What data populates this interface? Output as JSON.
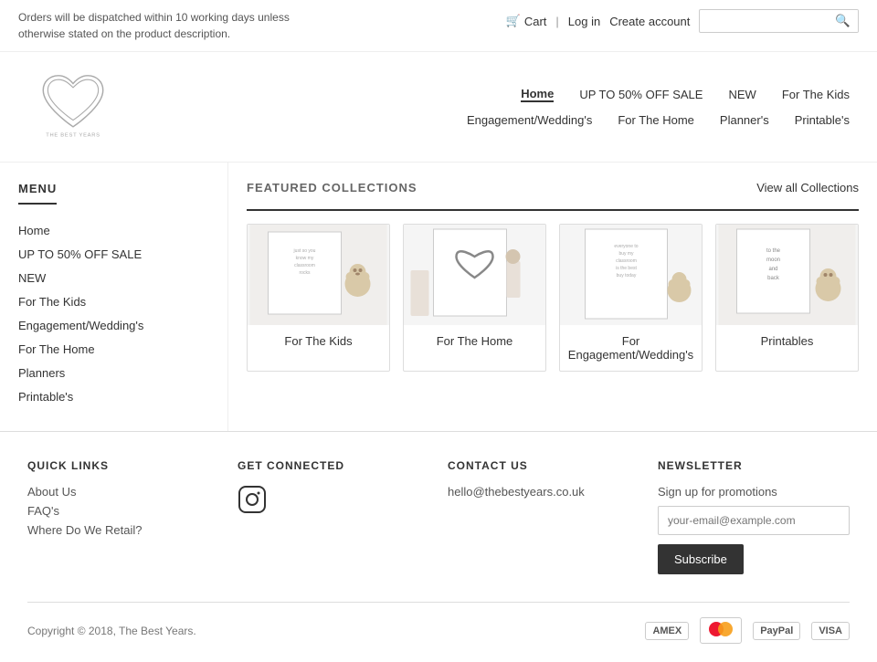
{
  "topbar": {
    "notice": "Orders will be dispatched within 10 working days unless otherwise stated on the product description.",
    "cart_label": "Cart",
    "login_label": "Log in",
    "create_account_label": "Create account",
    "search_placeholder": ""
  },
  "header": {
    "logo_alt": "The Best Years",
    "logo_text_line1": "THE BEST YEARS",
    "nav": {
      "items": [
        {
          "label": "Home",
          "active": true
        },
        {
          "label": "UP TO 50% OFF SALE",
          "active": false
        },
        {
          "label": "NEW",
          "active": false
        },
        {
          "label": "For The Kids",
          "active": false
        },
        {
          "label": "Engagement/Wedding's",
          "active": false
        },
        {
          "label": "For The Home",
          "active": false
        },
        {
          "label": "Planner's",
          "active": false
        },
        {
          "label": "Printable's",
          "active": false
        }
      ]
    }
  },
  "sidebar": {
    "menu_label": "MENU",
    "items": [
      {
        "label": "Home"
      },
      {
        "label": "UP TO 50% OFF SALE"
      },
      {
        "label": "NEW"
      },
      {
        "label": "For The Kids"
      },
      {
        "label": "Engagement/Wedding's"
      },
      {
        "label": "For The Home"
      },
      {
        "label": "Planners"
      },
      {
        "label": "Printable's"
      }
    ]
  },
  "collections": {
    "section_title": "FEATURED COLLECTIONS",
    "view_all_label": "View all Collections",
    "items": [
      {
        "label": "For The Kids"
      },
      {
        "label": "For The Home"
      },
      {
        "label": "For Engagement/Wedding's"
      },
      {
        "label": "Printables"
      }
    ]
  },
  "footer": {
    "quick_links_title": "QUICK LINKS",
    "quick_links": [
      {
        "label": "About Us"
      },
      {
        "label": "FAQ's"
      },
      {
        "label": "Where Do We Retail?"
      }
    ],
    "get_connected_title": "GET CONNECTED",
    "contact_title": "CONTACT US",
    "contact_email": "hello@thebestyears.co.uk",
    "newsletter_title": "NEWSLETTER",
    "newsletter_note": "Sign up for promotions",
    "newsletter_placeholder": "your-email@example.com",
    "subscribe_label": "Subscribe",
    "copyright": "Copyright © 2018, The Best Years.",
    "payment_methods": [
      "AMEX",
      "MASTER",
      "PAYPAL",
      "VISA"
    ]
  }
}
